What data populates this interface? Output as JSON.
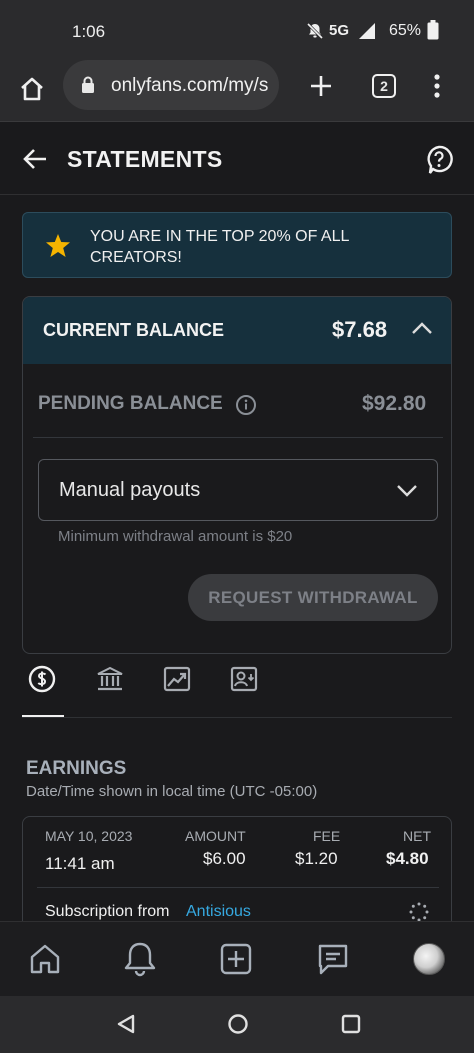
{
  "status": {
    "time": "1:06",
    "network": "5G",
    "battery": "65%"
  },
  "browser": {
    "url": "onlyfans.com/my/s",
    "tab_count": "2"
  },
  "header": {
    "title": "STATEMENTS"
  },
  "banner": {
    "text": "YOU ARE IN THE TOP 20% OF ALL CREATORS!"
  },
  "balance": {
    "current_label": "CURRENT BALANCE",
    "current_value": "$7.68",
    "pending_label": "PENDING BALANCE",
    "pending_value": "$92.80",
    "payout_select": "Manual payouts",
    "min_note": "Minimum withdrawal amount is $20",
    "withdraw_label": "REQUEST WITHDRAWAL"
  },
  "tabs": [
    {
      "name": "earnings",
      "icon": "dollar-circle-icon",
      "active": true
    },
    {
      "name": "bank",
      "icon": "bank-icon",
      "active": false
    },
    {
      "name": "stats",
      "icon": "chart-icon",
      "active": false
    },
    {
      "name": "account",
      "icon": "person-card-icon",
      "active": false
    }
  ],
  "earnings": {
    "title": "EARNINGS",
    "subtitle": "Date/Time shown in local time (UTC -05:00)",
    "headers": {
      "date": "MAY 10, 2023",
      "amount": "AMOUNT",
      "fee": "FEE",
      "net": "NET"
    },
    "row": {
      "time": "11:41 am",
      "amount": "$6.00",
      "fee": "$1.20",
      "net": "$4.80"
    },
    "desc_prefix": "Subscription from",
    "desc_link": "Antisious"
  },
  "colors": {
    "accent": "#36a9e1",
    "banner_bg": "#16303d",
    "star": "#f5b400"
  }
}
